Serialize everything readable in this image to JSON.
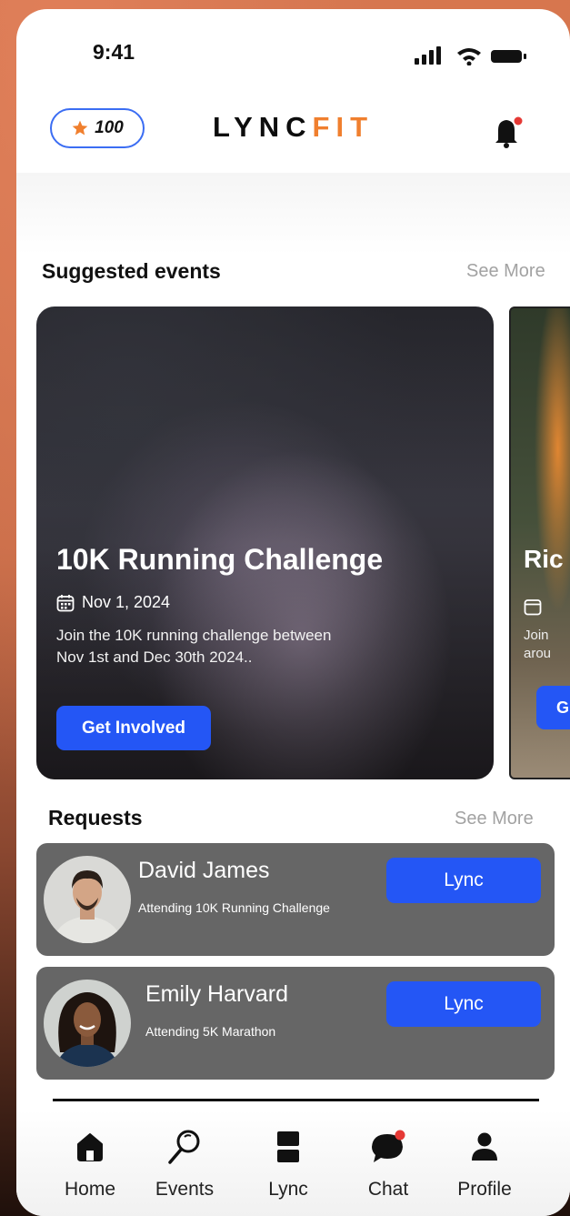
{
  "status_bar": {
    "time": "9:41"
  },
  "header": {
    "points": "100",
    "logo_dark": "LYNC",
    "logo_accent": "FIT",
    "accent_color": "#f07f2e",
    "notification_dot": true
  },
  "suggested": {
    "title": "Suggested events",
    "see_more": "See More",
    "events": [
      {
        "title": "10K Running Challenge",
        "date": "Nov 1, 2024",
        "description": "Join the 10K running challenge between Nov 1st  and Dec 30th 2024..",
        "button": "Get Involved"
      },
      {
        "title": "Ric",
        "description_line1": "Join",
        "description_line2": "arou",
        "button": "G"
      }
    ]
  },
  "requests": {
    "title": "Requests",
    "see_more": "See More",
    "items": [
      {
        "name": "David James",
        "subtitle": "Attending 10K Running Challenge",
        "button": "Lync"
      },
      {
        "name": "Emily Harvard",
        "subtitle": "Attending 5K Marathon",
        "button": "Lync"
      }
    ]
  },
  "nav": {
    "items": [
      {
        "label": "Home",
        "icon": "home-icon"
      },
      {
        "label": "Events",
        "icon": "search-icon"
      },
      {
        "label": "Lync",
        "icon": "lync-icon"
      },
      {
        "label": "Chat",
        "icon": "chat-icon"
      },
      {
        "label": "Profile",
        "icon": "profile-icon"
      }
    ]
  },
  "colors": {
    "primary": "#2456f5",
    "card_bg": "#666666"
  }
}
